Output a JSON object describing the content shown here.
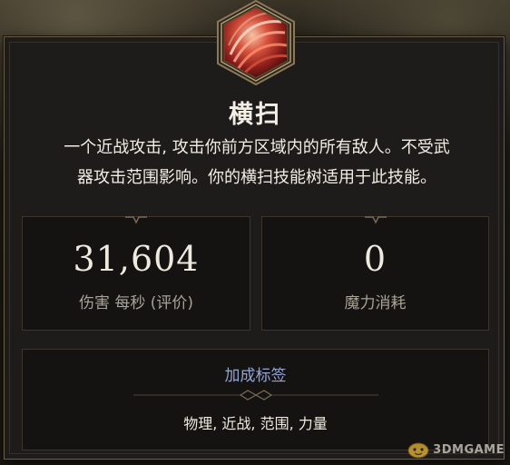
{
  "skill": {
    "name": "横扫",
    "description_line1": "一个近战攻击, 攻击你前方区域内的所有敌人。不受武",
    "description_line2": "器攻击范围影响。你的横扫技能树适用于此技能。"
  },
  "stats": {
    "damage": {
      "value": "31,604",
      "label": "伤害 每秒 (评价)"
    },
    "mana": {
      "value": "0",
      "label": "魔力消耗"
    }
  },
  "tags": {
    "title": "加成标签",
    "value": "物理, 近战, 范围, 力量"
  },
  "watermark": {
    "text": "3DMGAME",
    "icon": "gamepad-icon"
  },
  "colors": {
    "panel_border": "#6b5c45",
    "tag_title": "#93a5d6",
    "icon_red": "#c8352b"
  }
}
